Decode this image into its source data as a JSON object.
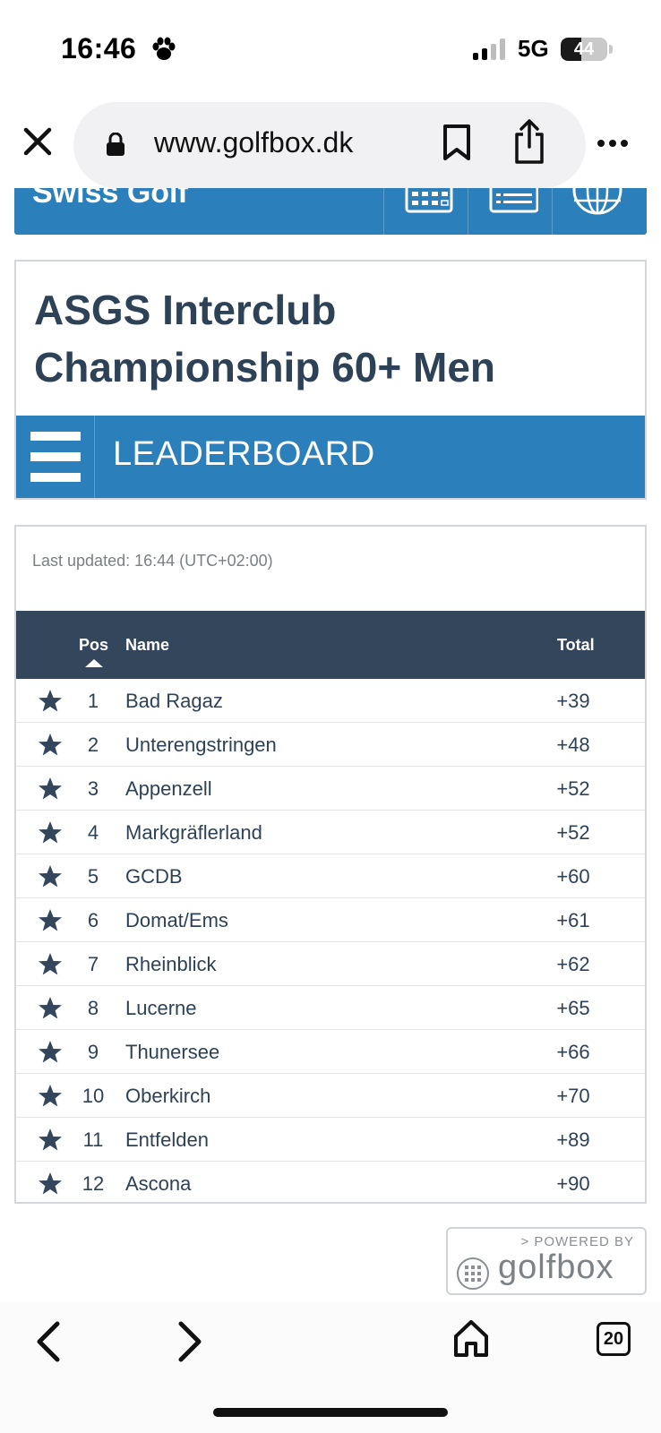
{
  "status_bar": {
    "time": "16:46",
    "network": "5G",
    "battery": "44",
    "battery_level": 0.44
  },
  "browser": {
    "url": "www.golfbox.dk",
    "tab_count": "20"
  },
  "site": {
    "name": "Swiss Golf",
    "accent": "#2b7fbb",
    "header_dark": "#34465b"
  },
  "page": {
    "title": "ASGS Interclub Championship 60+ Men",
    "section": "LEADERBOARD",
    "last_updated": "Last updated: 16:44 (UTC+02:00)"
  },
  "table": {
    "headers": {
      "pos": "Pos",
      "name": "Name",
      "total": "Total"
    },
    "rows": [
      {
        "pos": "1",
        "name": "Bad Ragaz",
        "total": "+39"
      },
      {
        "pos": "2",
        "name": "Unterengstringen",
        "total": "+48"
      },
      {
        "pos": "3",
        "name": "Appenzell",
        "total": "+52"
      },
      {
        "pos": "4",
        "name": "Markgräflerland",
        "total": "+52"
      },
      {
        "pos": "5",
        "name": "GCDB",
        "total": "+60"
      },
      {
        "pos": "6",
        "name": "Domat/Ems",
        "total": "+61"
      },
      {
        "pos": "7",
        "name": "Rheinblick",
        "total": "+62"
      },
      {
        "pos": "8",
        "name": "Lucerne",
        "total": "+65"
      },
      {
        "pos": "9",
        "name": "Thunersee",
        "total": "+66"
      },
      {
        "pos": "10",
        "name": "Oberkirch",
        "total": "+70"
      },
      {
        "pos": "11",
        "name": "Entfelden",
        "total": "+89"
      },
      {
        "pos": "12",
        "name": "Ascona",
        "total": "+90"
      }
    ]
  },
  "footer": {
    "powered_by": "> POWERED BY",
    "logo": "golfbox"
  }
}
